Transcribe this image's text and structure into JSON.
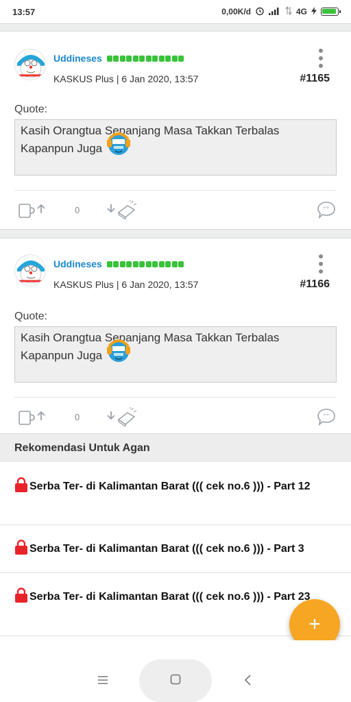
{
  "status_bar": {
    "time": "13:57",
    "speed": "0,00K/d",
    "network": "4G"
  },
  "posts": [
    {
      "username": "Uddineses",
      "meta": "KASKUS Plus | 6 Jan 2020, 13:57",
      "post_number": "#1165",
      "quote_label": "Quote:",
      "quote_line1": "Kasih Orangtua Sepanjang Masa Takkan Terbalas",
      "quote_line2": "Kapanpun Juga",
      "vote_count": "0"
    },
    {
      "username": "Uddineses",
      "meta": "KASKUS Plus | 6 Jan 2020, 13:57",
      "post_number": "#1166",
      "quote_label": "Quote:",
      "quote_line1": "Kasih Orangtua Sepanjang Masa Takkan Terbalas",
      "quote_line2": "Kapanpun Juga",
      "vote_count": "0"
    }
  ],
  "recommendations": {
    "header": "Rekomendasi Untuk Agan",
    "items": [
      {
        "title": "Serba Ter- di Kalimantan Barat ((( cek no.6 ))) - Part 12"
      },
      {
        "title": "Serba Ter- di Kalimantan Barat ((( cek no.6 ))) - Part 3"
      },
      {
        "title": "Serba Ter- di Kalimantan Barat ((( cek no.6 ))) - Part 23"
      }
    ]
  },
  "fab": {
    "label": "+"
  },
  "colors": {
    "username": "#1a87c9",
    "reputation": "#39c23a",
    "fab": "#f6a623",
    "lock": "#e8232a"
  },
  "icons": {
    "alarm": "alarm-icon",
    "signal": "signal-icon",
    "battery": "battery-icon",
    "more": "more-vert-icon",
    "upvote": "cendol-upvote-icon",
    "downvote": "bata-downvote-icon",
    "reply": "reply-bubble-icon",
    "lock": "lock-icon",
    "menu": "menu-icon",
    "home": "home-square-icon",
    "back": "back-chevron-icon"
  }
}
